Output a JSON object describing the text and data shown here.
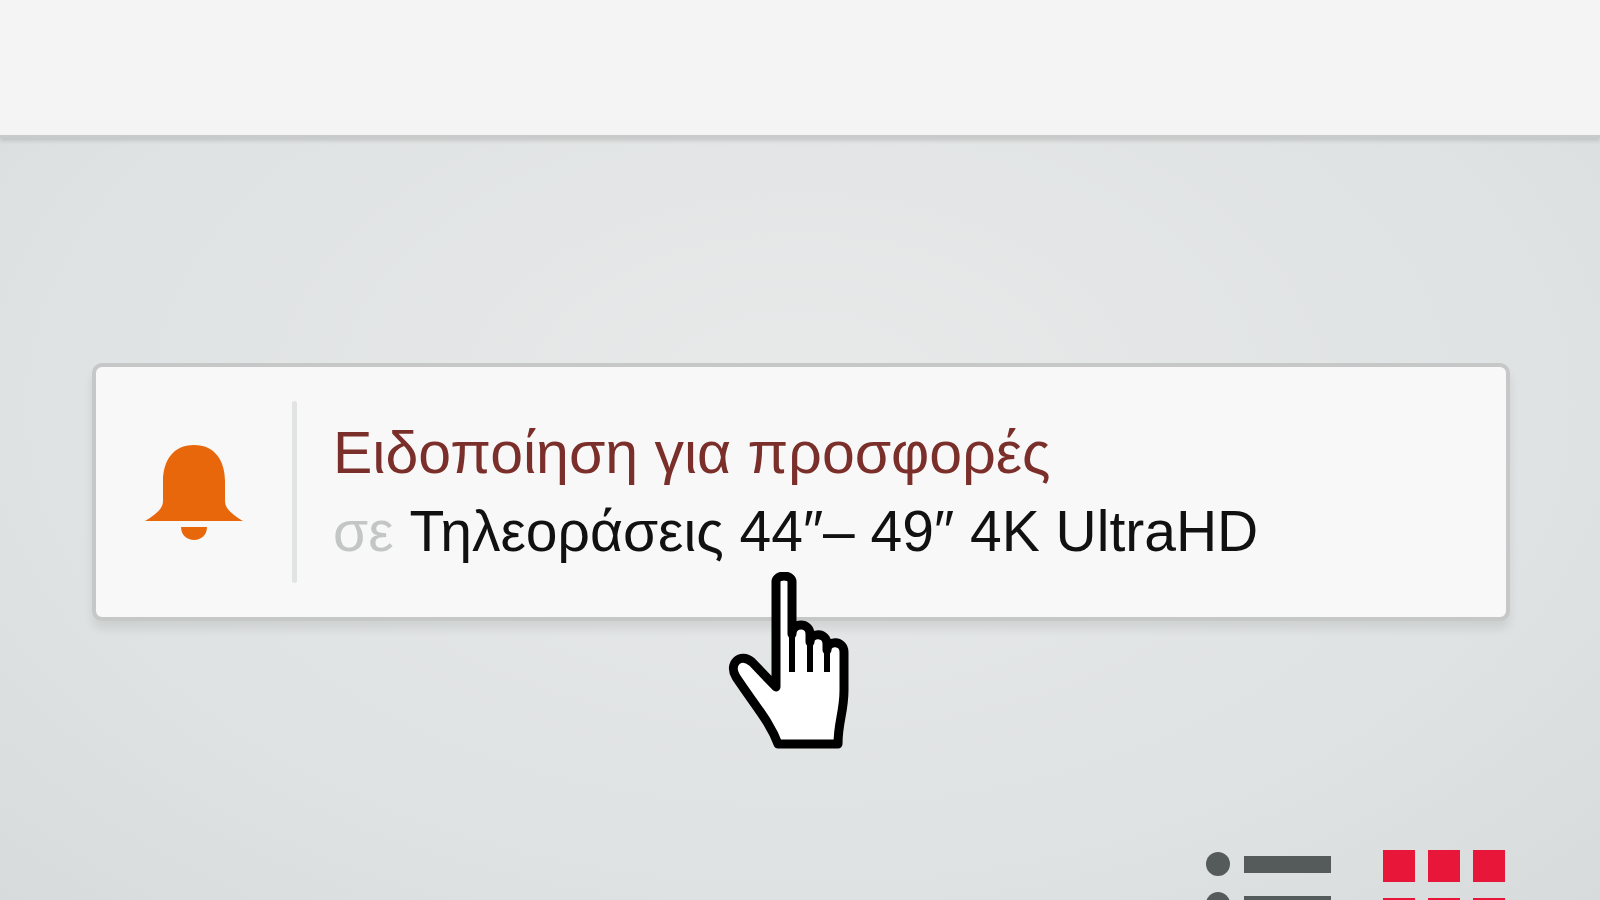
{
  "alert_card": {
    "title": "Ειδοποίηση για προσφορές",
    "prefix": "σε",
    "category": "Τηλεοράσεις 44″– 49″ 4K UltraHD"
  },
  "view_toggle": [
    {
      "kind": "list",
      "selected": false
    },
    {
      "kind": "grid",
      "selected": true
    }
  ]
}
